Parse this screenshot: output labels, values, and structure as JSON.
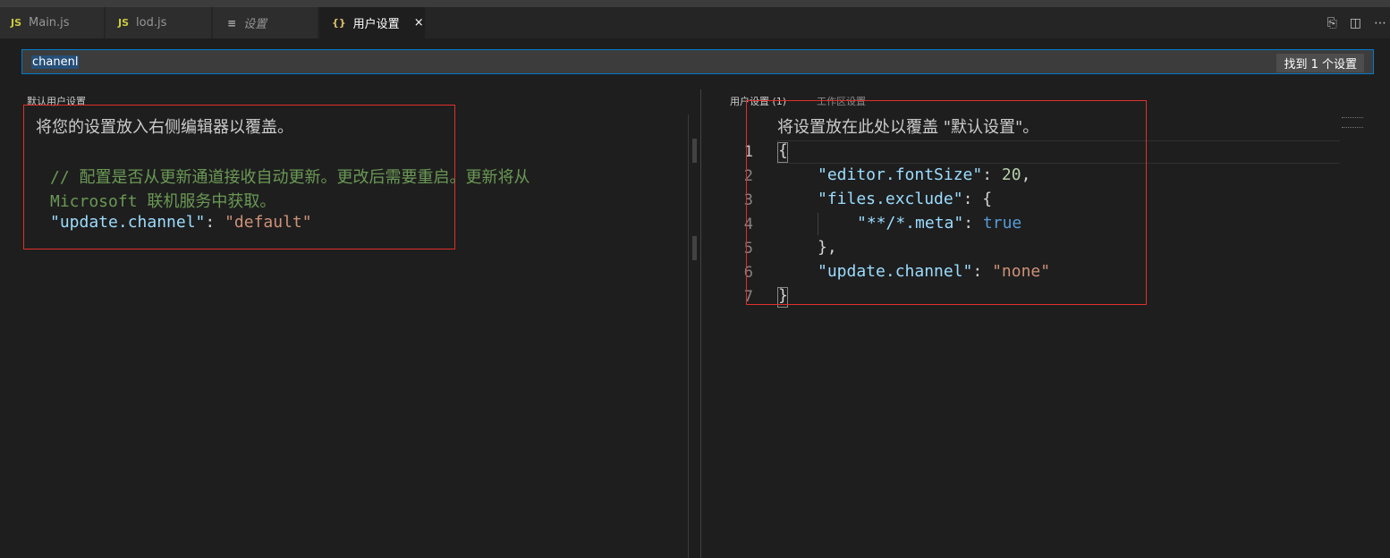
{
  "tabs": [
    {
      "icon": "JS",
      "label": "Main.js"
    },
    {
      "icon": "JS",
      "label": "lod.js"
    },
    {
      "icon": "≡",
      "label": "设置"
    },
    {
      "icon": "{}",
      "label": "用户设置",
      "close": "×"
    }
  ],
  "search": {
    "query": "chanenl",
    "result_count": "找到 1 个设置"
  },
  "left": {
    "header": "默认用户设置",
    "banner": "将您的设置放入右侧编辑器以覆盖。",
    "comment_line1": "// 配置是否从更新通道接收自动更新。更改后需要重启。更新将从",
    "comment_line2": "Microsoft 联机服务中获取。",
    "setting_key": "\"update.channel\"",
    "setting_value": "\"default\""
  },
  "right": {
    "header_user": "用户设置 (1)",
    "header_workspace": "工作区设置",
    "banner": "将设置放在此处以覆盖 \"默认设置\"。",
    "line_numbers": [
      "1",
      "2",
      "3",
      "4",
      "5",
      "6",
      "7"
    ],
    "code": {
      "open_brace": "{",
      "font_size_key": "\"editor.fontSize\"",
      "font_size_value": "20",
      "files_exclude_key": "\"files.exclude\"",
      "meta_key": "\"**/*.meta\"",
      "meta_value": "true",
      "inner_close": "},",
      "channel_key": "\"update.channel\"",
      "channel_value": "\"none\"",
      "close_brace": "}"
    }
  },
  "colors": {
    "background": "#1e1e1e",
    "accent": "#007acc",
    "highlight_box": "#e0302a",
    "string": "#ce9178",
    "key": "#9cdcfe",
    "comment": "#6a9955",
    "keyword": "#569cd6"
  }
}
